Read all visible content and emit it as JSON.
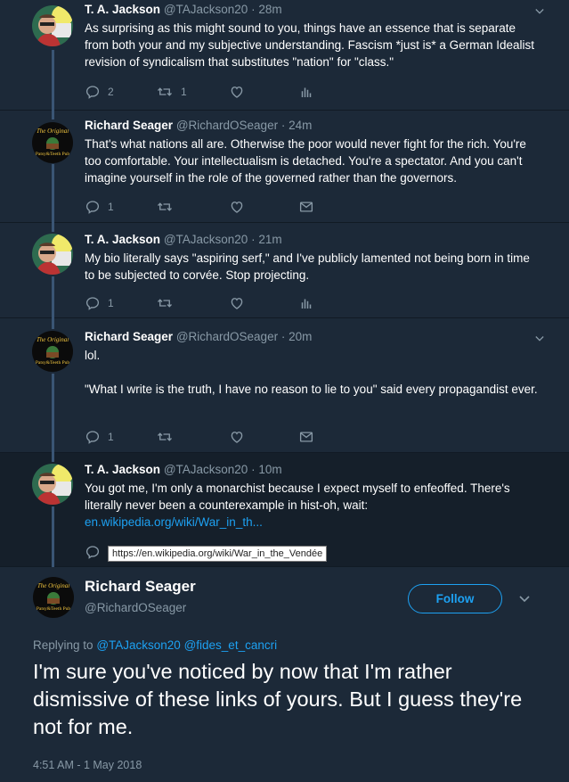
{
  "tweets": [
    {
      "name": "T. A. Jackson",
      "handle": "@TAJackson20",
      "time": "28m",
      "text": "As surprising as this might sound to you, things have an essence that is separate from both your and my subjective understanding. Fascism *just is* a German Idealist revision of syndicalism that substitutes \"nation\" for \"class.\"",
      "reply_count": "2",
      "retweet_count": "1"
    },
    {
      "name": "Richard Seager",
      "handle": "@RichardOSeager",
      "time": "24m",
      "text": "That's what nations all are. Otherwise the poor would never fight for the rich. You're too comfortable. Your intellectualism is detached. You're a spectator. And you can't imagine yourself in the role of the governed rather than the governors.",
      "reply_count": "1"
    },
    {
      "name": "T. A. Jackson",
      "handle": "@TAJackson20",
      "time": "21m",
      "text": "My bio literally says \"aspiring serf,\" and I've publicly lamented not being born in time to be subjected to corvée. Stop projecting.",
      "reply_count": "1"
    },
    {
      "name": "Richard Seager",
      "handle": "@RichardOSeager",
      "time": "20m",
      "text": "lol.\n\n\"What I write is the truth, I have no reason to lie to you\" said every propagandist ever.",
      "reply_count": "1"
    },
    {
      "name": "T. A. Jackson",
      "handle": "@TAJackson20",
      "time": "10m",
      "text": "You got me, I'm only a monarchist because I expect myself to enfeoffed. There's literally never been a counterexample in hist-oh, wait:",
      "link": "en.wikipedia.org/wiki/War_in_th..."
    }
  ],
  "tooltip": "https://en.wikipedia.org/wiki/War_in_the_Vendée",
  "dot": "·",
  "main": {
    "name": "Richard Seager",
    "handle": "@RichardOSeager",
    "follow_label": "Follow",
    "replying_prefix": "Replying to",
    "replying_1": "@TAJackson20",
    "replying_2": "@fides_et_cancri",
    "text": "I'm sure you've noticed by now that I'm rather dismissive of these links of yours. But I guess they're not for me.",
    "timestamp": "4:51 AM - 1 May 2018"
  },
  "colors": {
    "background": "#1c2938",
    "link": "#1da1f2",
    "muted": "#8899a6",
    "thread_line": "#3a5574"
  },
  "icons": [
    "reply-icon",
    "retweet-icon",
    "like-icon",
    "analytics-icon",
    "message-icon",
    "chevron-down-icon"
  ]
}
